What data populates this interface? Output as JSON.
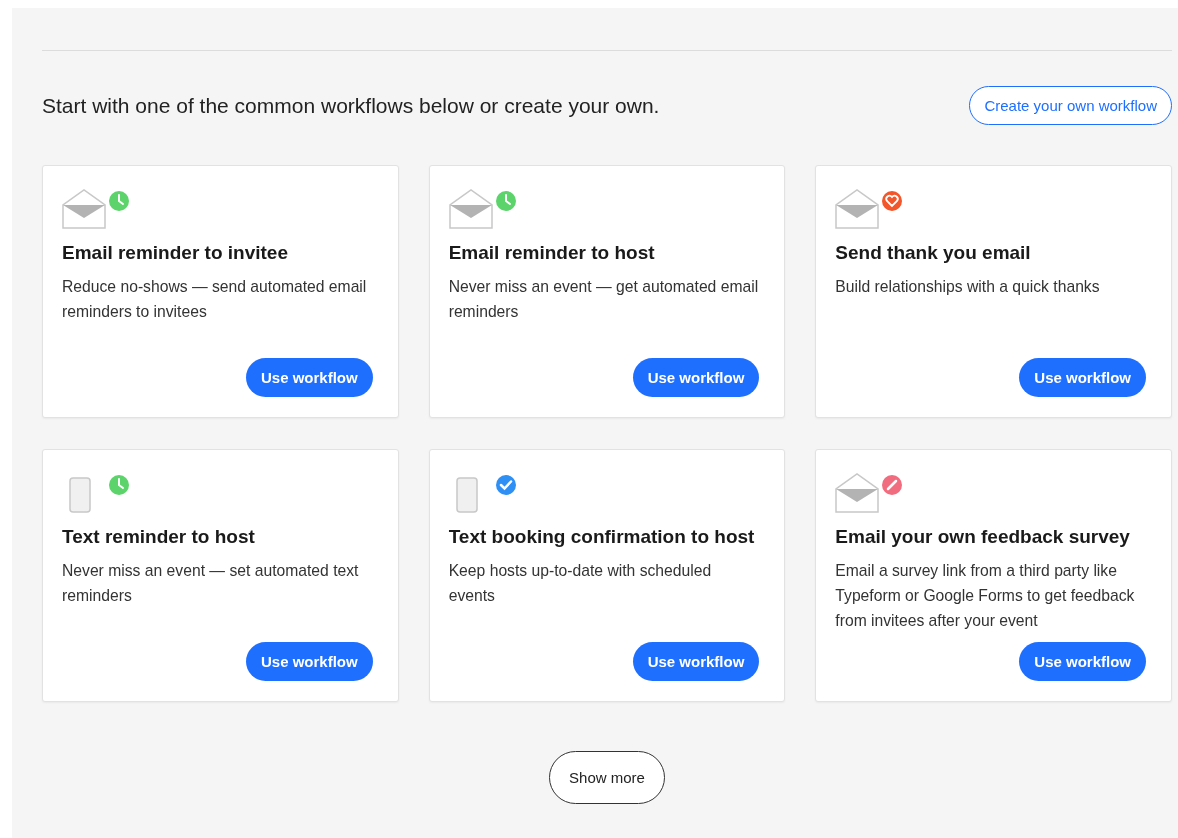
{
  "intro": "Start with one of the common workflows below or create your own.",
  "create_button": "Create your own workflow",
  "workflows": [
    {
      "kind": "email",
      "badge": {
        "kind": "clock",
        "color": "#5dd36b"
      },
      "title": "Email reminder to invitee",
      "description": "Reduce no-shows — send automated email reminders to invitees",
      "button": "Use workflow"
    },
    {
      "kind": "email",
      "badge": {
        "kind": "clock",
        "color": "#5dd36b"
      },
      "title": "Email reminder to host",
      "description": "Never miss an event — get automated email reminders",
      "button": "Use workflow"
    },
    {
      "kind": "email",
      "badge": {
        "kind": "heart",
        "color": "#f2562a"
      },
      "title": "Send thank you email",
      "description": "Build relationships with a quick thanks",
      "button": "Use workflow"
    },
    {
      "kind": "phone",
      "badge": {
        "kind": "clock",
        "color": "#5dd36b"
      },
      "title": "Text reminder to host",
      "description": "Never miss an event — set automated text reminders",
      "button": "Use workflow"
    },
    {
      "kind": "phone",
      "badge": {
        "kind": "check",
        "color": "#2e8ff5"
      },
      "title": "Text booking confirmation to host",
      "description": "Keep hosts up-to-date with scheduled events",
      "button": "Use workflow"
    },
    {
      "kind": "email",
      "badge": {
        "kind": "pencil",
        "color": "#f06c7e"
      },
      "title": "Email your own feedback survey",
      "description": "Email a survey link from a third party like Typeform or Google Forms to get feedback from invitees after your event",
      "button": "Use workflow"
    }
  ],
  "show_more": "Show more"
}
